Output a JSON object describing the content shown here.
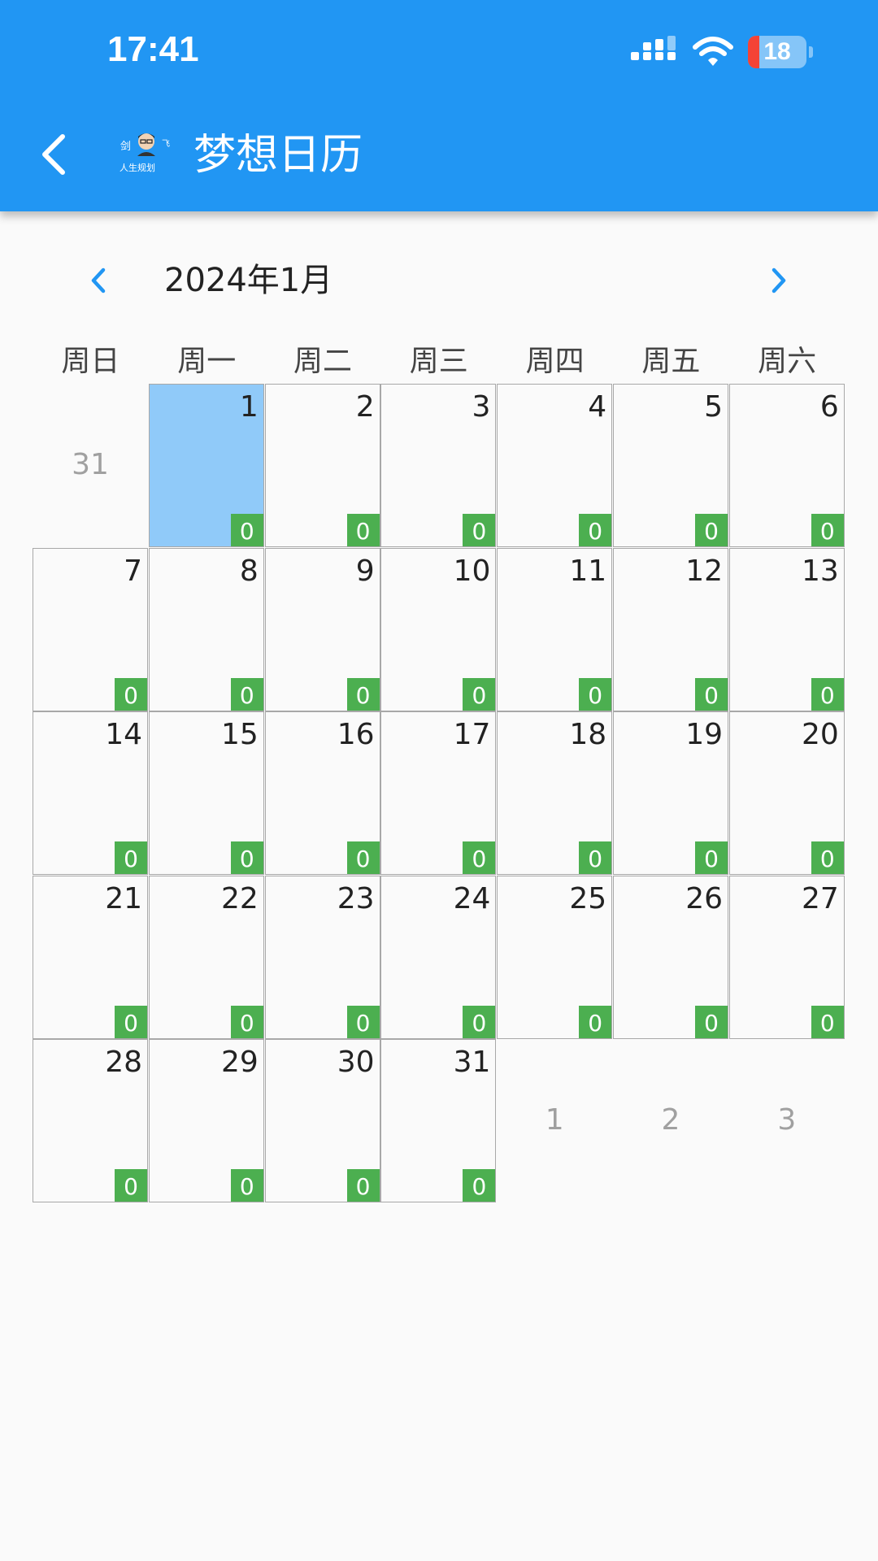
{
  "status_bar": {
    "time": "17:41",
    "battery_level": "18",
    "battery_color": "#f44336"
  },
  "header": {
    "title": "梦想日历",
    "background": "#2196f3",
    "back_icon": "chevron-left-icon",
    "logo_top_left": "剑",
    "logo_top_right": "飞",
    "logo_bottom": "人生规划"
  },
  "calendar": {
    "month_label": "2024年1月",
    "prev_icon": "chevron-left-icon",
    "next_icon": "chevron-right-icon",
    "accent_color": "#2196f3",
    "selected_color": "#90caf9",
    "badge_color": "#4caf50",
    "weekdays": [
      "周日",
      "周一",
      "周二",
      "周三",
      "周四",
      "周五",
      "周六"
    ],
    "leading_days": [
      "31"
    ],
    "days": [
      {
        "day": "1",
        "count": "0",
        "selected": true
      },
      {
        "day": "2",
        "count": "0"
      },
      {
        "day": "3",
        "count": "0"
      },
      {
        "day": "4",
        "count": "0"
      },
      {
        "day": "5",
        "count": "0"
      },
      {
        "day": "6",
        "count": "0"
      },
      {
        "day": "7",
        "count": "0"
      },
      {
        "day": "8",
        "count": "0"
      },
      {
        "day": "9",
        "count": "0"
      },
      {
        "day": "10",
        "count": "0"
      },
      {
        "day": "11",
        "count": "0"
      },
      {
        "day": "12",
        "count": "0"
      },
      {
        "day": "13",
        "count": "0"
      },
      {
        "day": "14",
        "count": "0"
      },
      {
        "day": "15",
        "count": "0"
      },
      {
        "day": "16",
        "count": "0"
      },
      {
        "day": "17",
        "count": "0"
      },
      {
        "day": "18",
        "count": "0"
      },
      {
        "day": "19",
        "count": "0"
      },
      {
        "day": "20",
        "count": "0"
      },
      {
        "day": "21",
        "count": "0"
      },
      {
        "day": "22",
        "count": "0"
      },
      {
        "day": "23",
        "count": "0"
      },
      {
        "day": "24",
        "count": "0"
      },
      {
        "day": "25",
        "count": "0"
      },
      {
        "day": "26",
        "count": "0"
      },
      {
        "day": "27",
        "count": "0"
      },
      {
        "day": "28",
        "count": "0"
      },
      {
        "day": "29",
        "count": "0"
      },
      {
        "day": "30",
        "count": "0"
      },
      {
        "day": "31",
        "count": "0"
      }
    ],
    "trailing_days": [
      "1",
      "2",
      "3"
    ]
  }
}
